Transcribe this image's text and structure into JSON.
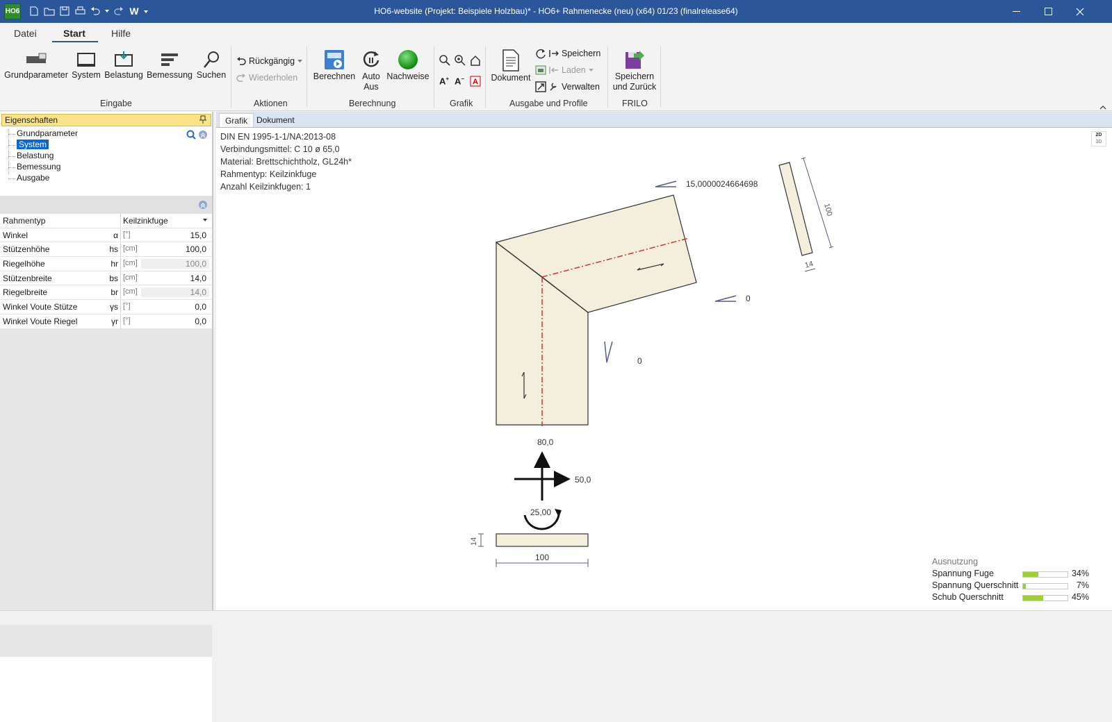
{
  "window": {
    "title": "HO6-website (Projekt: Beispiele Holzbau)* - HO6+ Rahmenecke (neu) (x64) 01/23 (finalrelease64)",
    "app_logo": "HO6"
  },
  "ribbon_tabs": [
    "Datei",
    "Start",
    "Hilfe"
  ],
  "ribbon": {
    "eingabe": {
      "label": "Eingabe",
      "buttons": [
        "Grundparameter",
        "System",
        "Belastung",
        "Bemessung",
        "Suchen"
      ]
    },
    "aktionen": {
      "label": "Aktionen",
      "undo": "Rückgängig",
      "redo": "Wiederholen"
    },
    "berechnung": {
      "label": "Berechnung",
      "berechnen": "Berechnen",
      "auto": "Auto",
      "aus": "Aus",
      "nachweise": "Nachweise"
    },
    "grafik": {
      "label": "Grafik"
    },
    "ausgabe": {
      "label": "Ausgabe und Profile",
      "dokument": "Dokument",
      "speichern": "Speichern",
      "laden": "Laden",
      "verwalten": "Verwalten"
    },
    "frilo": {
      "label": "FRILO",
      "speichern_zurueck_1": "Speichern",
      "speichern_zurueck_2": "und Zurück"
    }
  },
  "properties": {
    "header": "Eigenschaften",
    "tree": [
      "Grundparameter",
      "System",
      "Belastung",
      "Bemessung",
      "Ausgabe"
    ],
    "selected": "System",
    "rows": [
      {
        "name": "Rahmentyp",
        "symbol": "",
        "unit": "",
        "value": "Keilzinkfuge",
        "type": "select"
      },
      {
        "name": "Winkel",
        "symbol": "α",
        "unit": "[°]",
        "value": "15,0",
        "type": "edit"
      },
      {
        "name": "Stützenhöhe",
        "symbol": "hs",
        "unit": "[cm]",
        "value": "100,0",
        "type": "edit"
      },
      {
        "name": "Riegelhöhe",
        "symbol": "hr",
        "unit": "[cm]",
        "value": "100,0",
        "type": "readonly"
      },
      {
        "name": "Stützenbreite",
        "symbol": "bs",
        "unit": "[cm]",
        "value": "14,0",
        "type": "edit"
      },
      {
        "name": "Riegelbreite",
        "symbol": "br",
        "unit": "[cm]",
        "value": "14,0",
        "type": "readonly"
      },
      {
        "name": "Winkel Voute Stütze",
        "symbol": "γs",
        "unit": "[°]",
        "value": "0,0",
        "type": "edit"
      },
      {
        "name": "Winkel Voute Riegel",
        "symbol": "γr",
        "unit": "[°]",
        "value": "0,0",
        "type": "edit"
      }
    ]
  },
  "content_tabs": [
    "Grafik",
    "Dokument"
  ],
  "graphic": {
    "info_lines": [
      "DIN EN 1995-1-1/NA:2013-08",
      "Verbindungsmittel: C 10 ø 65,0",
      "Material: Brettschichtholz, GL24h*",
      "Rahmentyp:  Keilzinkfuge",
      "Anzahl Keilzinkfugen: 1"
    ],
    "angle_top_label": "15,0000024664698",
    "angle_right_label": "0",
    "angle_col_label": "0",
    "beam_dim_length": "100",
    "beam_dim_width": "14",
    "load_vertical": "80,0",
    "load_horizontal": "50,0",
    "moment": "25,00",
    "section_height": "14",
    "section_width": "100",
    "view_toggle": [
      "2D",
      "3D"
    ]
  },
  "utilization": {
    "title": "Ausnutzung",
    "rows": [
      {
        "label": "Spannung Fuge",
        "pct": "34%",
        "value": 34
      },
      {
        "label": "Spannung Querschnitt",
        "pct": "7%",
        "value": 7
      },
      {
        "label": "Schub Querschnitt",
        "pct": "45%",
        "value": 45
      }
    ]
  },
  "colors": {
    "titlebar": "#2b579a",
    "panel_header": "#fbe38a",
    "selected": "#0a66d6",
    "timber_fill": "#f3efdc",
    "axis_line": "#cc3333",
    "util_fill": "#9ccf3a"
  }
}
